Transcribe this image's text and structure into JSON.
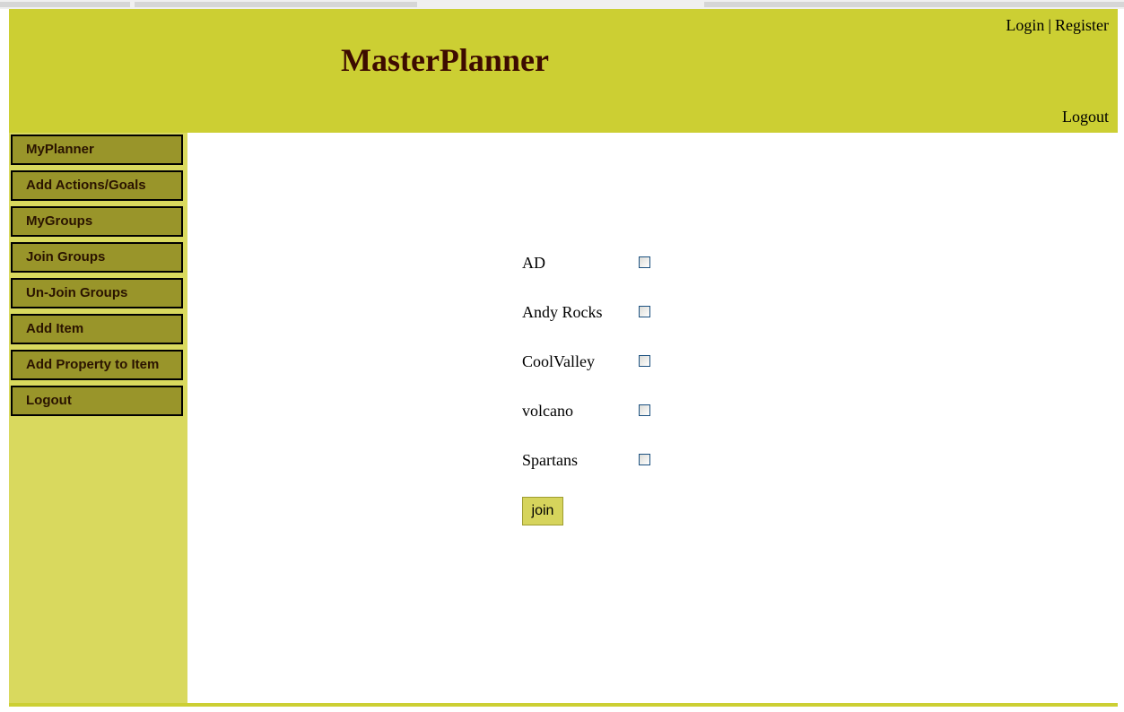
{
  "site": {
    "title": "MasterPlanner"
  },
  "header": {
    "login_label": "Login",
    "separator": "|",
    "register_label": "Register",
    "logout_label": "Logout"
  },
  "sidebar": {
    "items": [
      {
        "label": "MyPlanner"
      },
      {
        "label": "Add Actions/Goals"
      },
      {
        "label": "MyGroups"
      },
      {
        "label": "Join Groups"
      },
      {
        "label": "Un-Join Groups"
      },
      {
        "label": "Add Item"
      },
      {
        "label": "Add Property to Item"
      },
      {
        "label": "Logout"
      }
    ]
  },
  "groups": [
    {
      "name": "AD",
      "checked": false
    },
    {
      "name": "Andy Rocks",
      "checked": false
    },
    {
      "name": "CoolValley",
      "checked": false
    },
    {
      "name": "volcano",
      "checked": false
    },
    {
      "name": "Spartans",
      "checked": false
    }
  ],
  "form": {
    "join_label": "join"
  },
  "colors": {
    "header_bg": "#cccf33",
    "title_text": "#3d0b00",
    "sidebar_bg": "#d9d95e",
    "menu_item_bg": "#99952a",
    "button_bg": "#d6d45c"
  }
}
